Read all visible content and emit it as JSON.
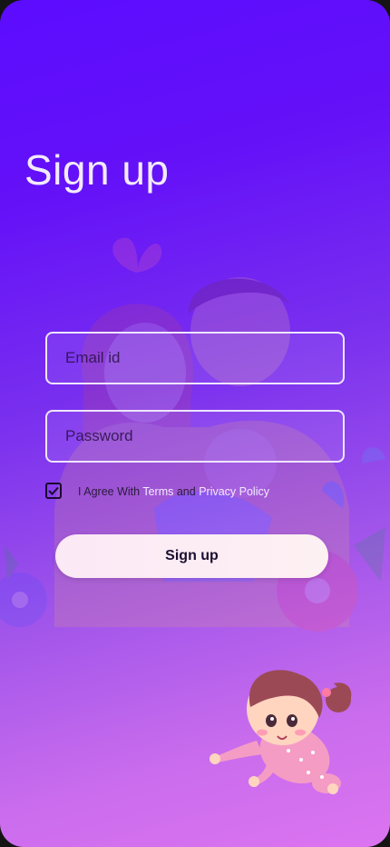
{
  "header": {
    "title": "Sign up"
  },
  "form": {
    "email": {
      "placeholder": "Email id",
      "value": ""
    },
    "password": {
      "placeholder": "Password",
      "value": ""
    },
    "agree": {
      "checked": true,
      "prefix": "I Agree With ",
      "terms": "Terms",
      "and": " and ",
      "privacy": "Privacy Policy"
    },
    "submit_label": "Sign up"
  },
  "colors": {
    "gradient_top": "#5c0cff",
    "gradient_bottom": "#dc74f0",
    "link": "#f3eaff",
    "button_bg": "#fbe9f6"
  }
}
